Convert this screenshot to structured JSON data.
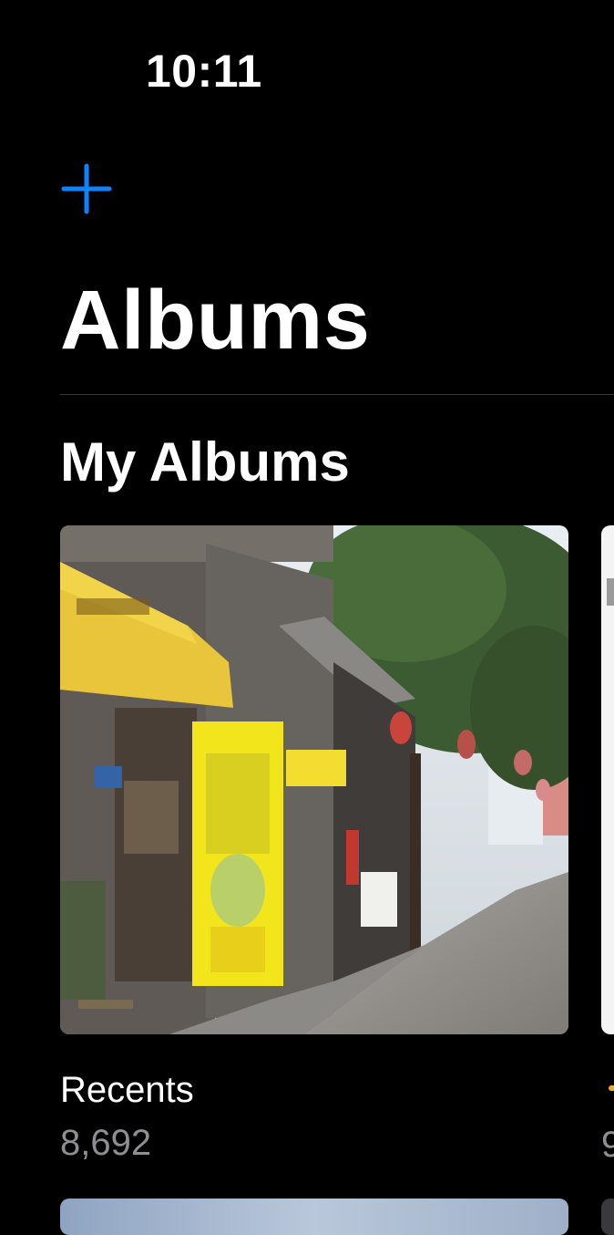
{
  "status_bar": {
    "time": "10:11"
  },
  "toolbar": {
    "add_icon": "plus-icon",
    "accent_color": "#0a84ff"
  },
  "header": {
    "title": "Albums"
  },
  "my_albums": {
    "section_title": "My Albums",
    "albums": [
      {
        "name": "Recents",
        "count": "8,692"
      }
    ],
    "next_album_peek": {
      "count_partial": "9"
    }
  },
  "colors": {
    "background": "#000000",
    "secondary_text": "#8e8e93"
  }
}
